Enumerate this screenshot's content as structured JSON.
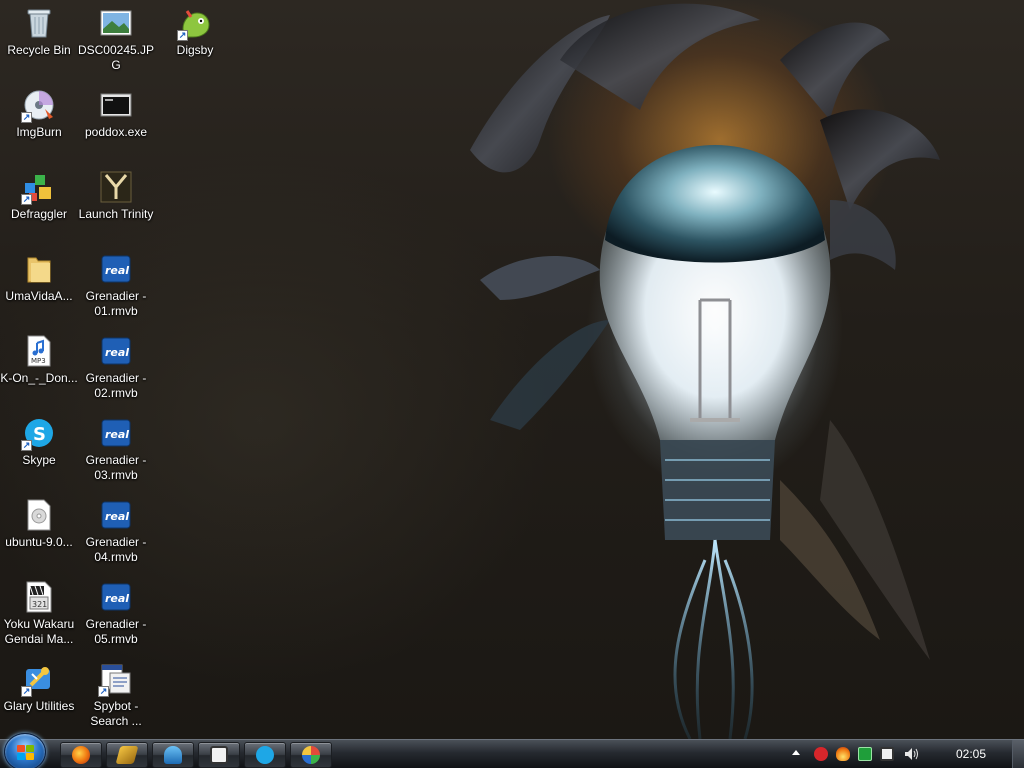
{
  "desktop_icons": [
    {
      "name": "recycle-bin",
      "label": "Recycle Bin",
      "icon": "recycle-bin-icon"
    },
    {
      "name": "dsc-image",
      "label": "DSC00245.JPG",
      "icon": "image-file-icon"
    },
    {
      "name": "digsby",
      "label": "Digsby",
      "icon": "digsby-icon"
    },
    {
      "name": "imgburn",
      "label": "ImgBurn",
      "icon": "disc-burner-icon"
    },
    {
      "name": "poddox",
      "label": "poddox.exe",
      "icon": "executable-icon"
    },
    {
      "name": "defraggler",
      "label": "Defraggler",
      "icon": "defrag-icon"
    },
    {
      "name": "launch-trinity",
      "label": "Launch Trinity",
      "icon": "trinity-icon"
    },
    {
      "name": "umavida",
      "label": "UmaVidaA...",
      "icon": "folder-icon"
    },
    {
      "name": "grenadier-01",
      "label": "Grenadier - 01.rmvb",
      "icon": "real-media-icon"
    },
    {
      "name": "k-on",
      "label": "K-On_-_Don...",
      "icon": "mp3-file-icon"
    },
    {
      "name": "grenadier-02",
      "label": "Grenadier - 02.rmvb",
      "icon": "real-media-icon"
    },
    {
      "name": "skype",
      "label": "Skype",
      "icon": "skype-icon"
    },
    {
      "name": "grenadier-03",
      "label": "Grenadier - 03.rmvb",
      "icon": "real-media-icon"
    },
    {
      "name": "ubuntu",
      "label": "ubuntu-9.0...",
      "icon": "iso-file-icon"
    },
    {
      "name": "grenadier-04",
      "label": "Grenadier - 04.rmvb",
      "icon": "real-media-icon"
    },
    {
      "name": "yoku-wakaru",
      "label": "Yoku Wakaru Gendai Ma...",
      "icon": "video-file-icon"
    },
    {
      "name": "grenadier-05",
      "label": "Grenadier - 05.rmvb",
      "icon": "real-media-icon"
    },
    {
      "name": "glary-utilities",
      "label": "Glary Utilities",
      "icon": "glary-icon"
    },
    {
      "name": "spybot",
      "label": "Spybot - Search ...",
      "icon": "spybot-icon"
    }
  ],
  "taskbar": {
    "start_icon": "windows-orb-icon",
    "buttons": [
      {
        "name": "firefox",
        "icon": "firefox-icon"
      },
      {
        "name": "winamp",
        "icon": "winamp-icon"
      },
      {
        "name": "network",
        "icon": "network-icon"
      },
      {
        "name": "console",
        "icon": "console-icon"
      },
      {
        "name": "skype",
        "icon": "skype-icon"
      },
      {
        "name": "paint",
        "icon": "paint-icon"
      }
    ],
    "tray_icons": [
      "show-hidden-icon",
      "digsby-tray-icon",
      "flame-tray-icon",
      "utorrent-tray-icon",
      "monitor-tray-icon",
      "volume-icon"
    ],
    "clock": "02:05"
  },
  "colors": {
    "real_media": "#1f5fb5",
    "taskbar": "#262a30",
    "accent_glow": "#ffb347"
  }
}
